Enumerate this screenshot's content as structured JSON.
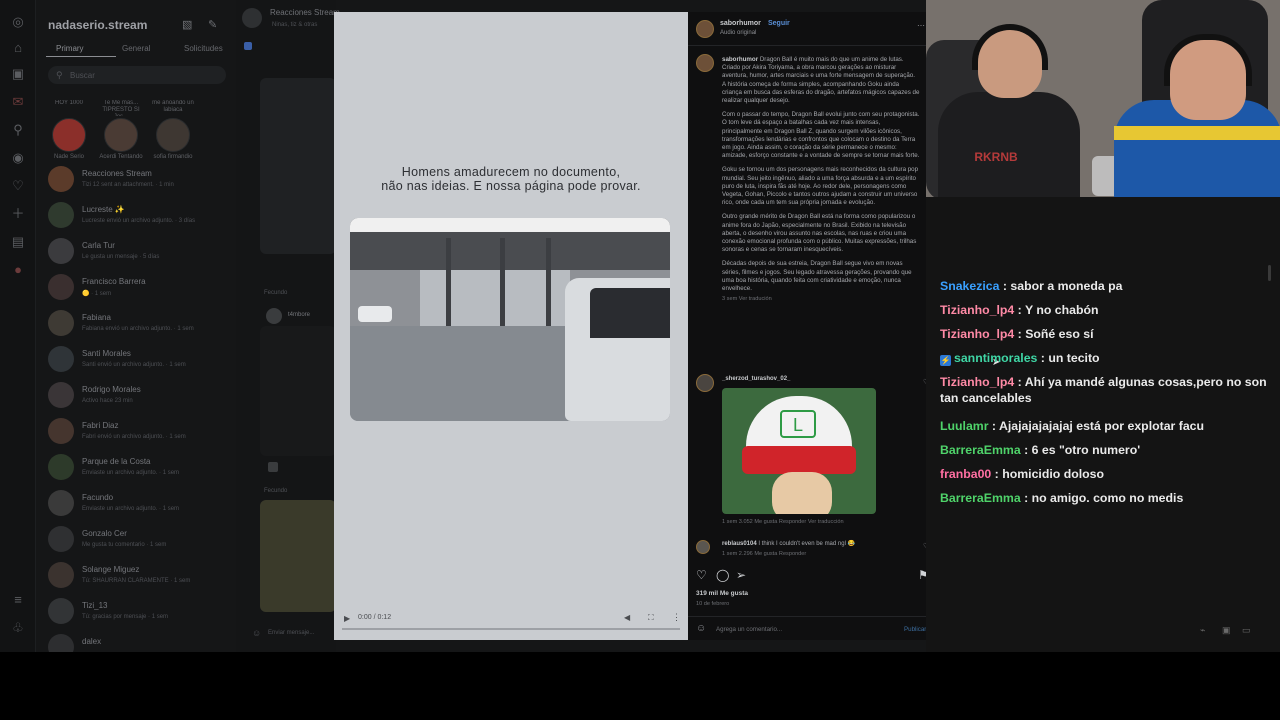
{
  "inbox": {
    "title": "nadaserio.stream",
    "tabs": [
      "Primary",
      "General",
      "Solicitudes"
    ],
    "search_placeholder": "Buscar",
    "notes": [
      {
        "bubble": "HOY 1000",
        "name": "Nade Serio"
      },
      {
        "bubble": "Te Me mas... TIPRESTO SI Jes...",
        "name": "Acerdi Tentando"
      },
      {
        "bubble": "me anoando un labiaca",
        "name": "sofia firmandio"
      }
    ],
    "conversations": [
      {
        "name": "Reacciones Stream",
        "preview": "Tizi 12 sent an attachment. · 1 min"
      },
      {
        "name": "Lucreste ✨",
        "preview": "Lucreste envió un archivo adjunto. · 3 días"
      },
      {
        "name": "Carla Tur",
        "preview": "Le gusta un mensaje · 5 días"
      },
      {
        "name": "Francisco Barrera",
        "preview": "🟡 · 1 sem"
      },
      {
        "name": "Fabiana",
        "preview": "Fabiana envió un archivo adjunto. · 1 sem"
      },
      {
        "name": "Santi Morales",
        "preview": "Santi envió un archivo adjunto. · 1 sem"
      },
      {
        "name": "Rodrigo Morales",
        "preview": "Activo hace 23 min"
      },
      {
        "name": "Fabri Diaz",
        "preview": "Fabri envió un archivo adjunto. · 1 sem"
      },
      {
        "name": "Parque de la Costa",
        "preview": "Enviaste un archivo adjunto. · 1 sem"
      },
      {
        "name": "Facundo",
        "preview": "Enviaste un archivo adjunto. · 1 sem"
      },
      {
        "name": "Gonzalo Cer",
        "preview": "Me gusta tu comentario · 1 sem"
      },
      {
        "name": "Solange Miguez",
        "preview": "Tú: SHAURRAN CLARAMENTE · 1 sem"
      },
      {
        "name": "Tizi_13",
        "preview": "Tú: gracias por mensaje · 1 sem"
      },
      {
        "name": "dalex",
        "preview": ""
      }
    ]
  },
  "thread": {
    "title": "Reacciones Stream",
    "subtitle": "Ninas, tiz & otras",
    "date_label": "Fecundo",
    "user": "t4mbore",
    "composer_placeholder": "Enviar mensaje..."
  },
  "post": {
    "overlay_text_line1": "Homens amadurecem no documento,",
    "overlay_text_line2": "não nas ideias. E nossa página pode provar.",
    "video_time": "0:00 / 0:12",
    "author": "saborhumor",
    "follow_label": "Seguir",
    "audio_label": "Audio original",
    "caption_user": "saborhumor",
    "caption_paragraphs": [
      "Dragon Ball é muito mais do que um anime de lutas. Criado por Akira Toriyama, a obra marcou gerações ao misturar aventura, humor, artes marciais e uma forte mensagem de superação. A história começa de forma simples, acompanhando Goku ainda criança em busca das esferas do dragão, artefatos mágicos capazes de realizar qualquer desejo.",
      "Com o passar do tempo, Dragon Ball evolui junto com seu protagonista. O tom leve dá espaço a batalhas cada vez mais intensas, principalmente em Dragon Ball Z, quando surgem vilões icônicos, transformações lendárias e confrontos que colocam o destino da Terra em jogo. Ainda assim, o coração da série permanece o mesmo: amizade, esforço constante e a vontade de sempre se tornar mais forte.",
      "Goku se tornou um dos personagens mais reconhecidos da cultura pop mundial. Seu jeito ingênuo, aliado a uma força absurda e a um espírito puro de luta, inspira fãs até hoje. Ao redor dele, personagens como Vegeta, Gohan, Piccolo e tantos outros ajudam a construir um universo rico, onde cada um tem sua própria jornada e evolução.",
      "Outro grande mérito de Dragon Ball está na forma como popularizou o anime fora do Japão, especialmente no Brasil. Exibido na televisão aberta, o desenho virou assunto nas escolas, nas ruas e criou uma conexão emocional profunda com o público. Muitas expressões, trilhas sonoras e cenas se tornaram inesquecíveis.",
      "Décadas depois de sua estreia, Dragon Ball segue vivo em novas séries, filmes e jogos. Seu legado atravessa gerações, provando que uma boa história, quando feita com criatividade e emoção, nunca envelhece."
    ],
    "caption_meta": "3 sem   Ver tradución",
    "comment1_user": "_sherzod_turashov_02_",
    "comment1_meta": "1 sem   3.052 Me gusta   Responder   Ver traducción",
    "comment2_user": "reblaus0104",
    "comment2_text": "I think I couldn't even be mad ngl 😂",
    "comment2_meta": "1 sem   2.296 Me gusta   Responder",
    "likes": "319 mil Me gusta",
    "date": "10 de febrero",
    "add_comment_placeholder": "Agrega un comentario...",
    "publish_label": "Publicar",
    "cap_logo": "L"
  },
  "webcam": {
    "shirt_logo": "RKRNB"
  },
  "chat": {
    "messages": [
      {
        "user": "Snakezica",
        "color": "#3aa0ff",
        "text": "sabor a moneda pa",
        "badge": false
      },
      {
        "user": "Tizianho_lp4",
        "color": "#ff8aa6",
        "text": "Y no chabón",
        "badge": false
      },
      {
        "user": "Tizianho_lp4",
        "color": "#ff8aa6",
        "text": "Soñé eso sí",
        "badge": false
      },
      {
        "user": "sanntimorales",
        "color": "#3fd6a5",
        "text": "un tecito",
        "badge": true
      },
      {
        "user": "Tizianho_lp4",
        "color": "#ff8aa6",
        "text": "Ahí ya mandé algunas cosas,pero no son tan cancelables",
        "badge": false
      },
      {
        "user": "Luulamr",
        "color": "#4fd36a",
        "text": "Ajajajajajajaj está por explotar facu",
        "badge": false
      },
      {
        "user": "BarreraEmma",
        "color": "#4fd36a",
        "text": "6 es \"otro numero'",
        "badge": false
      },
      {
        "user": "franba00",
        "color": "#ff6fa2",
        "text": "homicidio doloso",
        "badge": false
      },
      {
        "user": "BarreraEmma",
        "color": "#4fd36a",
        "text": "no amigo. como no medis",
        "badge": false
      }
    ],
    "badge_glyph": "⚡"
  }
}
